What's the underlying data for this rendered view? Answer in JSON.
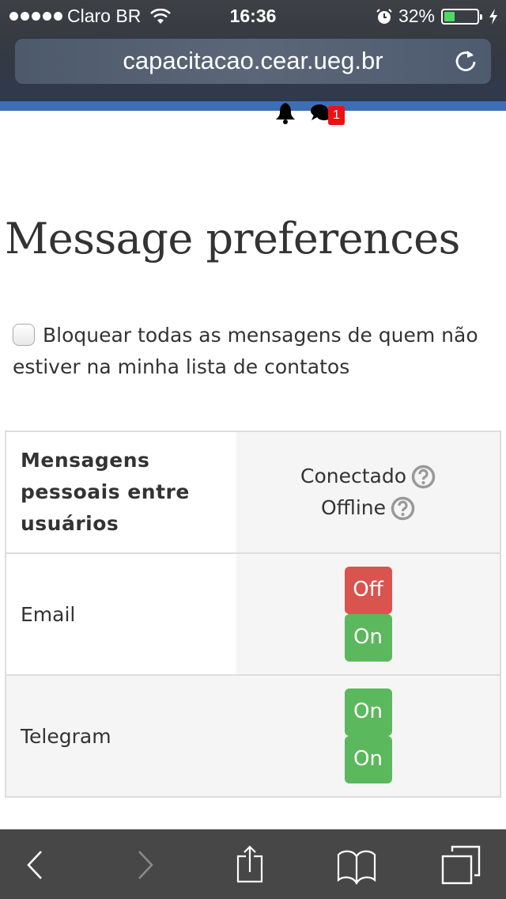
{
  "status_bar": {
    "carrier": "Claro BR",
    "signal_bars": 5,
    "time": "16:36",
    "battery_percent": "32%",
    "battery_level": 0.32,
    "icons": [
      "wifi-icon",
      "alarm-icon",
      "battery-icon",
      "charging-bolt-icon"
    ]
  },
  "browser": {
    "url": "capacitacao.cear.ueg.br",
    "reload_icon": "reload-icon"
  },
  "navbar": {
    "notifications_icon": "bell-icon",
    "messages_icon": "chat-icon",
    "messages_badge": "1"
  },
  "page": {
    "title": "Message preferences",
    "block_checkbox": {
      "label": "Bloquear todas as mensagens de quem não estiver na minha lista de contatos",
      "checked": false
    },
    "table": {
      "header": {
        "label": "Mensagens pessoais entre usuários",
        "columns": [
          {
            "label": "Conectado",
            "help_icon": "help-icon"
          },
          {
            "label": "Offline",
            "help_icon": "help-icon"
          }
        ]
      },
      "rows": [
        {
          "label": "Email",
          "states": [
            {
              "label": "Off",
              "color": "#d9534f"
            },
            {
              "label": "On",
              "color": "#5cb85c"
            }
          ]
        },
        {
          "label": "Telegram",
          "states": [
            {
              "label": "On",
              "color": "#5cb85c"
            },
            {
              "label": "On",
              "color": "#5cb85c"
            }
          ]
        }
      ]
    }
  },
  "toolbar": {
    "items": [
      "back-icon",
      "forward-icon",
      "share-icon",
      "bookmarks-icon",
      "tabs-icon"
    ]
  },
  "colors": {
    "nav_blue": "#3d6fb5",
    "off": "#d9534f",
    "on": "#5cb85c",
    "badge": "#ee1111"
  }
}
